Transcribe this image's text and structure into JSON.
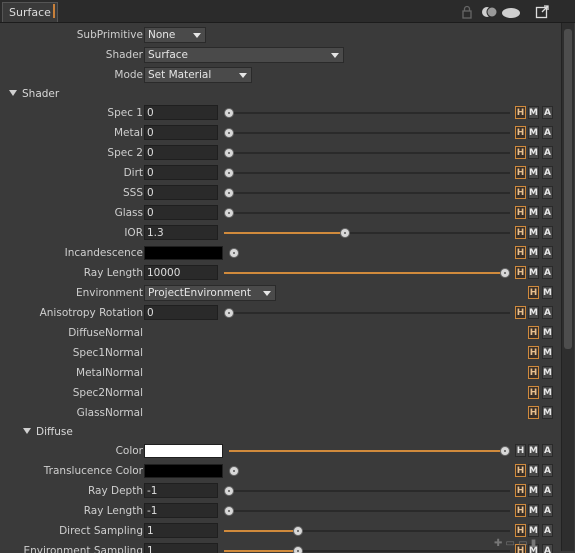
{
  "tab": {
    "title": "Surface"
  },
  "header": {
    "subprimitive_label": "SubPrimitive",
    "subprimitive_value": "None",
    "shader_label": "Shader",
    "shader_value": "Surface",
    "mode_label": "Mode",
    "mode_value": "Set Material"
  },
  "buttons": {
    "h": "H",
    "m": "M",
    "a": "A"
  },
  "shader_section": {
    "title": "Shader",
    "rows": [
      {
        "label": "Spec 1",
        "value": "0",
        "slider": 0.0,
        "hma": true
      },
      {
        "label": "Metal",
        "value": "0",
        "slider": 0.0,
        "hma": true
      },
      {
        "label": "Spec 2",
        "value": "0",
        "slider": 0.0,
        "hma": true
      },
      {
        "label": "Dirt",
        "value": "0",
        "slider": 0.0,
        "hma": true
      },
      {
        "label": "SSS",
        "value": "0",
        "slider": 0.0,
        "hma": true
      },
      {
        "label": "Glass",
        "value": "0",
        "slider": 0.0,
        "hma": true
      },
      {
        "label": "IOR",
        "value": "1.3",
        "slider": 0.42,
        "hma": true
      },
      {
        "label": "Incandescence",
        "color": "#000000",
        "hma": true
      },
      {
        "label": "Ray Length",
        "value": "10000",
        "slider": 1.0,
        "hma": true
      },
      {
        "label": "Environment",
        "dropdown": "ProjectEnvironment",
        "hm": true
      },
      {
        "label": "Anisotropy Rotation",
        "value": "0",
        "slider": 0.0,
        "hma": true
      },
      {
        "label": "DiffuseNormal",
        "hm": true
      },
      {
        "label": "Spec1Normal",
        "hm": true
      },
      {
        "label": "MetalNormal",
        "hm": true
      },
      {
        "label": "Spec2Normal",
        "hm": true
      },
      {
        "label": "GlassNormal",
        "hm": true
      }
    ]
  },
  "diffuse_section": {
    "title": "Diffuse",
    "rows": [
      {
        "label": "Color",
        "color": "#ffffff",
        "slider": 1.0,
        "hma_plain": true
      },
      {
        "label": "Translucence Color",
        "color": "#000000",
        "hma": true
      },
      {
        "label": "Ray Depth",
        "value": "-1",
        "slider": 0.0,
        "hma": true
      },
      {
        "label": "Ray Length",
        "value": "-1",
        "slider": 0.0,
        "hma": true
      },
      {
        "label": "Direct Sampling",
        "value": "1",
        "slider": 0.25,
        "hma": true
      },
      {
        "label": "Environment Sampling",
        "value": "1",
        "slider": 0.25,
        "hma": true
      }
    ]
  },
  "colors": {
    "accent": "#d08a3c"
  }
}
